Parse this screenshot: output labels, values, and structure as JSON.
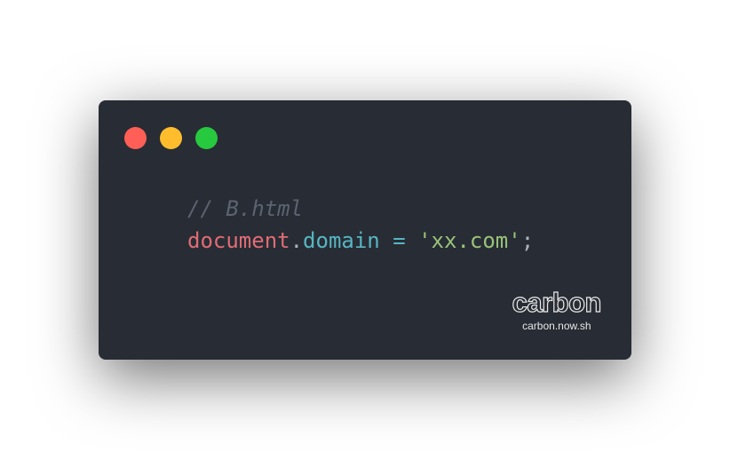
{
  "window": {
    "background": "#282c34",
    "controls": [
      {
        "name": "close-control",
        "color": "#ff5f56"
      },
      {
        "name": "minimize-control",
        "color": "#ffbd2e"
      },
      {
        "name": "zoom-control",
        "color": "#27c93f"
      }
    ]
  },
  "code": {
    "lines": [
      [
        {
          "text": "// B.html",
          "role": "comment",
          "color": "#5c6370"
        }
      ],
      [
        {
          "text": "document",
          "role": "identifier",
          "color": "#e06c75"
        },
        {
          "text": ".",
          "role": "punctuation",
          "color": "#abb2bf"
        },
        {
          "text": "domain",
          "role": "property",
          "color": "#56b6c2"
        },
        {
          "text": " ",
          "role": "space",
          "color": "#abb2bf"
        },
        {
          "text": "=",
          "role": "operator",
          "color": "#56b6c2"
        },
        {
          "text": " ",
          "role": "space",
          "color": "#abb2bf"
        },
        {
          "text": "'xx.com'",
          "role": "string",
          "color": "#98c379"
        },
        {
          "text": ";",
          "role": "punctuation",
          "color": "#abb2bf"
        }
      ]
    ]
  },
  "watermark": {
    "logo_text": "carbon",
    "url_text": "carbon.now.sh"
  }
}
